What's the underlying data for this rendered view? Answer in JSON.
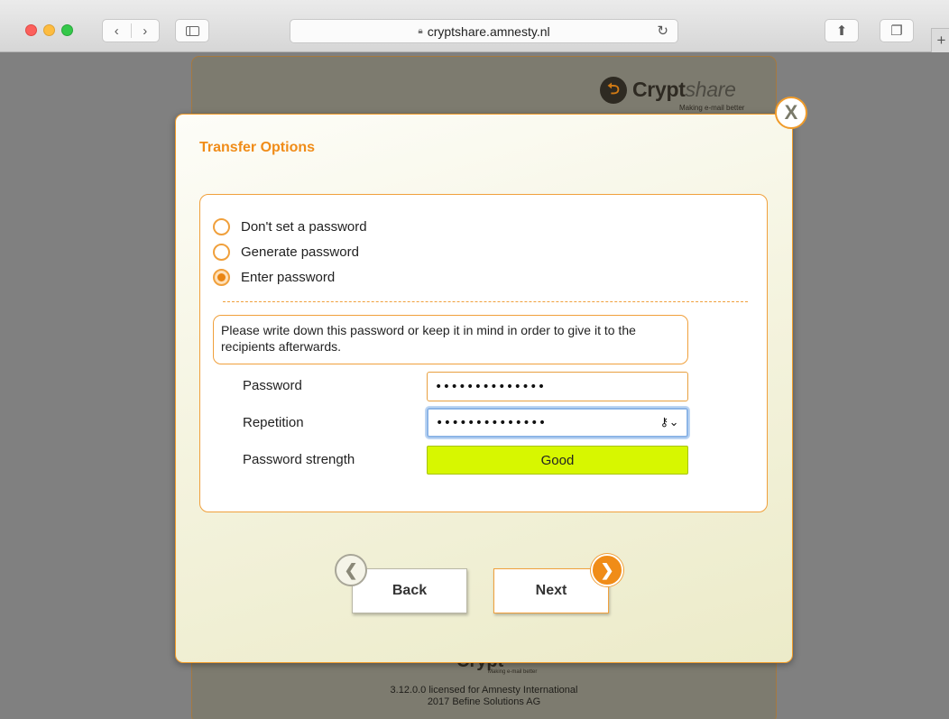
{
  "browser": {
    "url": "cryptshare.amnesty.nl",
    "back_icon": "chevron-left-icon",
    "forward_icon": "chevron-right-icon"
  },
  "brand": {
    "name_bold": "Crypt",
    "name_italic": "share",
    "tagline": "Making e-mail better",
    "accent": "#f08c18"
  },
  "footer": {
    "license": "3.12.0.0 licensed for Amnesty International",
    "copyright": "2017 Befine Solutions AG"
  },
  "modal": {
    "title": "Transfer Options",
    "close_label": "X",
    "radio_options": [
      {
        "label": "Don't set a password",
        "selected": false
      },
      {
        "label": "Generate password",
        "selected": false
      },
      {
        "label": "Enter password",
        "selected": true
      }
    ],
    "note": "Please write down this password or keep it in mind in order to give it to the recipients afterwards.",
    "password_label": "Password",
    "password_value": "••••••••••••••",
    "repetition_label": "Repetition",
    "repetition_value": "••••••••••••••",
    "strength_label": "Password strength",
    "strength_value": "Good",
    "strength_color": "#d7f700",
    "back_label": "Back",
    "next_label": "Next"
  }
}
